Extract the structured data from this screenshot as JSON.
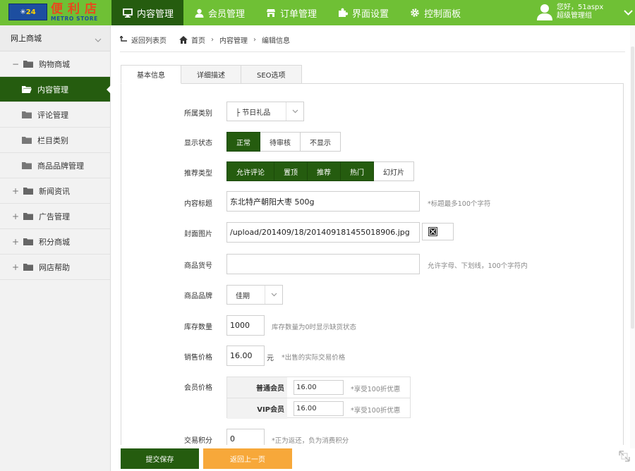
{
  "app": {
    "logo": {
      "badge": "24",
      "name_cn": "便利店",
      "name_en": "METRO STORE"
    }
  },
  "nav": {
    "items": [
      {
        "label": "内容管理",
        "icon": "monitor-icon"
      },
      {
        "label": "会员管理",
        "icon": "user-icon"
      },
      {
        "label": "订单管理",
        "icon": "shop-icon"
      },
      {
        "label": "界面设置",
        "icon": "puzzle-icon"
      },
      {
        "label": "控制面板",
        "icon": "gear-icon"
      }
    ],
    "active_index": 0
  },
  "user": {
    "greeting": "您好，51aspx",
    "role": "超级管理组"
  },
  "sidebar": {
    "header": "网上商城",
    "items": [
      {
        "label": "购物商城",
        "toggle": "−",
        "level": 0
      },
      {
        "label": "内容管理",
        "toggle": "",
        "level": 1,
        "active": true
      },
      {
        "label": "评论管理",
        "toggle": "",
        "level": 1
      },
      {
        "label": "栏目类别",
        "toggle": "",
        "level": 1
      },
      {
        "label": "商品品牌管理",
        "toggle": "",
        "level": 1
      },
      {
        "label": "新闻资讯",
        "toggle": "+",
        "level": 0
      },
      {
        "label": "广告管理",
        "toggle": "+",
        "level": 0
      },
      {
        "label": "积分商城",
        "toggle": "+",
        "level": 0
      },
      {
        "label": "网店帮助",
        "toggle": "+",
        "level": 0
      }
    ]
  },
  "breadcrumb": {
    "back": "返回列表页",
    "home": "首页",
    "section": "内容管理",
    "current": "编辑信息",
    "separator": "›"
  },
  "tabs": [
    "基本信息",
    "详细描述",
    "SEO选项"
  ],
  "form": {
    "category": {
      "label": "所属类别",
      "value": "├ 节日礼品"
    },
    "status": {
      "label": "显示状态",
      "options": [
        "正常",
        "待审核",
        "不显示"
      ],
      "selected": "正常"
    },
    "recommend": {
      "label": "推荐类型",
      "options": [
        "允许评论",
        "置顶",
        "推荐",
        "热门",
        "幻灯片"
      ],
      "selected": [
        "允许评论",
        "置顶",
        "推荐",
        "热门"
      ]
    },
    "title": {
      "label": "内容标题",
      "value": "东北特产朝阳大枣 500g",
      "hint": "*标题最多100个字符"
    },
    "cover": {
      "label": "封面图片",
      "value": "/upload/201409/18/201409181455018906.jpg"
    },
    "sku": {
      "label": "商品货号",
      "value": "",
      "hint": "允许字母、下划线，100个字符内"
    },
    "brand": {
      "label": "商品品牌",
      "value": "佳期"
    },
    "stock": {
      "label": "库存数量",
      "value": "1000",
      "hint": "库存数量为0时显示缺货状态"
    },
    "price": {
      "label": "销售价格",
      "value": "16.00",
      "unit": "元",
      "hint": "*出售的实际交易价格"
    },
    "member_price": {
      "label": "会员价格",
      "rows": [
        {
          "name": "普通会员",
          "value": "16.00",
          "hint": "*享受100折优惠"
        },
        {
          "name": "VIP会员",
          "value": "16.00",
          "hint": "*享受100折优惠"
        }
      ]
    },
    "points": {
      "label": "交易积分",
      "value": "0",
      "hint": "*正为返还，负为消费积分"
    }
  },
  "actions": {
    "submit": "提交保存",
    "back": "返回上一页"
  },
  "colors": {
    "topbar": "#6fc035",
    "dark_green": "#255c0f",
    "orange": "#f7a83a"
  }
}
